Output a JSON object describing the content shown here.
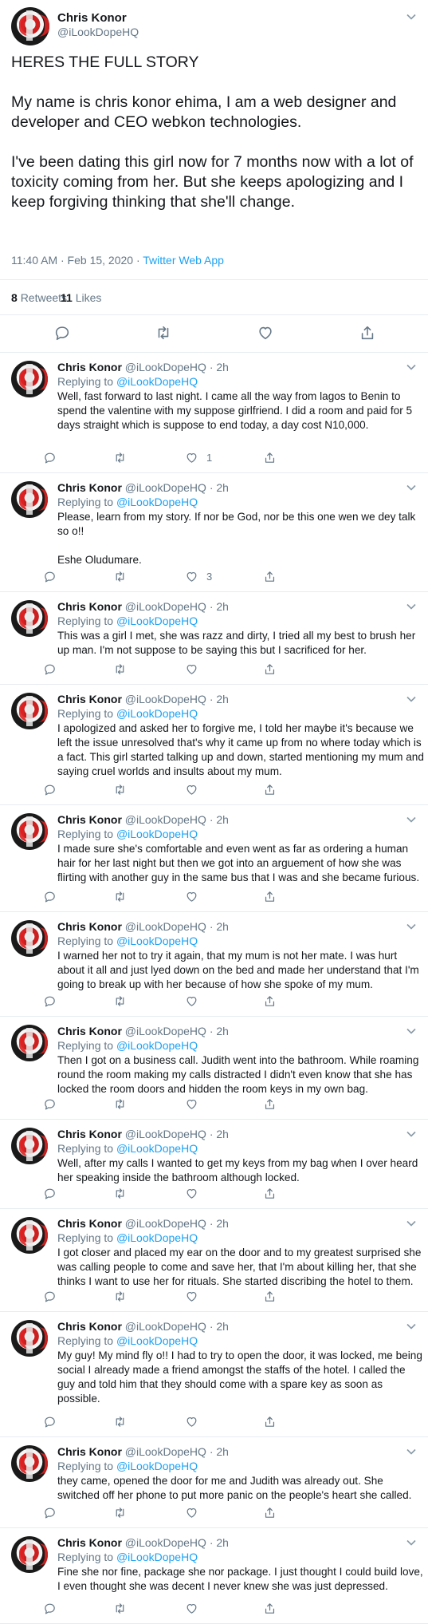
{
  "main_tweet": {
    "name": "Chris Konor",
    "handle": "@iLookDopeHQ",
    "paragraphs": [
      "HERES THE FULL STORY",
      "My name is chris konor ehima, I am a web designer and developer and CEO webkon technologies.",
      "I've been dating this girl now for 7 months now with a lot of toxicity coming from her. But she keeps apologizing and I keep forgiving thinking that she'll change."
    ],
    "timestamp": "11:40 AM · Feb 15, 2020 · ",
    "app": "Twitter Web App",
    "retweets_count": "8",
    "retweets_label": "Retweets",
    "likes_count": "11",
    "likes_label": "Likes"
  },
  "replies": [
    {
      "name": "Chris Konor",
      "meta": "@iLookDopeHQ · 2h",
      "replying_label": "Replying to ",
      "replying_to": "@iLookDopeHQ",
      "paragraphs": [
        "Well, fast forward to last night. I came all the way from lagos to Benin to spend the valentine with my suppose girlfriend. I did a room and paid for 5 days straight which is suppose to end today, a day cost N10,000."
      ],
      "likes": "1"
    },
    {
      "name": "Chris Konor",
      "meta": "@iLookDopeHQ · 2h",
      "replying_label": "Replying to ",
      "replying_to": "@iLookDopeHQ",
      "paragraphs": [
        "Please, learn from my story. If nor be God, nor be this one wen we dey talk so o!!",
        "Eshe Oludumare."
      ],
      "likes": "3"
    },
    {
      "name": "Chris Konor",
      "meta": "@iLookDopeHQ · 2h",
      "replying_label": "Replying to ",
      "replying_to": "@iLookDopeHQ",
      "paragraphs": [
        "This was a girl I met, she was razz and dirty, I tried all my best to brush her up man. I'm not suppose to be saying this but I sacrificed for her."
      ],
      "likes": ""
    },
    {
      "name": "Chris Konor",
      "meta": "@iLookDopeHQ · 2h",
      "replying_label": "Replying to ",
      "replying_to": "@iLookDopeHQ",
      "paragraphs": [
        "I apologized and asked her to forgive me, I told her maybe it's because we left the issue unresolved that's why it came up from no where today which is a fact. This girl started talking up and down, started mentioning my mum and saying cruel worlds and insults about my mum."
      ],
      "likes": ""
    },
    {
      "name": "Chris Konor",
      "meta": "@iLookDopeHQ · 2h",
      "replying_label": "Replying to ",
      "replying_to": "@iLookDopeHQ",
      "paragraphs": [
        "I made sure she's comfortable and even went as far as ordering a human hair for her last night but then we got into an arguement of how she was flirting with another guy in the same bus that I was and she became furious."
      ],
      "likes": ""
    },
    {
      "name": "Chris Konor",
      "meta": "@iLookDopeHQ · 2h",
      "replying_label": "Replying to ",
      "replying_to": "@iLookDopeHQ",
      "paragraphs": [
        "I warned her not to try it again, that my mum is not her mate. I was hurt about it all and just lyed down on the bed and made her understand that I'm going to break up with her because of how she spoke of my mum."
      ],
      "likes": ""
    },
    {
      "name": "Chris Konor",
      "meta": "@iLookDopeHQ · 2h",
      "replying_label": "Replying to ",
      "replying_to": "@iLookDopeHQ",
      "paragraphs": [
        "Then I got on a business call. Judith went into the bathroom. While roaming round the room making my calls distracted I didn't even know that she has locked the room doors and  hidden the room keys in my own bag."
      ],
      "likes": ""
    },
    {
      "name": "Chris Konor",
      "meta": "@iLookDopeHQ · 2h",
      "replying_label": "Replying to ",
      "replying_to": "@iLookDopeHQ",
      "paragraphs": [
        "Well, after my calls I wanted to get my keys from my bag when I over heard her speaking inside the bathroom although locked."
      ],
      "likes": ""
    },
    {
      "name": "Chris Konor",
      "meta": "@iLookDopeHQ · 2h",
      "replying_label": "Replying to ",
      "replying_to": "@iLookDopeHQ",
      "paragraphs": [
        "I got closer and placed my ear on the door and to my greatest surprised she was calling people to come and save her, that I'm about killing her, that she thinks I want to use her for rituals. She started discribing the hotel to them."
      ],
      "likes": ""
    },
    {
      "name": "Chris Konor",
      "meta": "@iLookDopeHQ · 2h",
      "replying_label": "Replying to ",
      "replying_to": "@iLookDopeHQ",
      "paragraphs": [
        "My guy! My mind fly o!! I had to try to open the door, it was locked, me being social I already made a friend amongst the staffs of the hotel. I called the guy and told him that they should come with a spare key as soon as possible."
      ],
      "likes": ""
    },
    {
      "name": "Chris Konor",
      "meta": "@iLookDopeHQ · 2h",
      "replying_label": "Replying to ",
      "replying_to": "@iLookDopeHQ",
      "paragraphs": [
        "they came, opened the door for me and Judith was already out. She switched off her phone to put more panic on the people's heart she called."
      ],
      "likes": ""
    },
    {
      "name": "Chris Konor",
      "meta": "@iLookDopeHQ · 2h",
      "replying_label": "Replying to ",
      "replying_to": "@iLookDopeHQ",
      "paragraphs": [
        "Fine she nor fine, package she nor package. I just thought I could build love, I even thought she was decent I never knew she was just depressed."
      ],
      "likes": ""
    }
  ],
  "colors": {
    "link": "#1da1f2",
    "secondary_text": "#657786",
    "divider": "#e6ecf0"
  }
}
